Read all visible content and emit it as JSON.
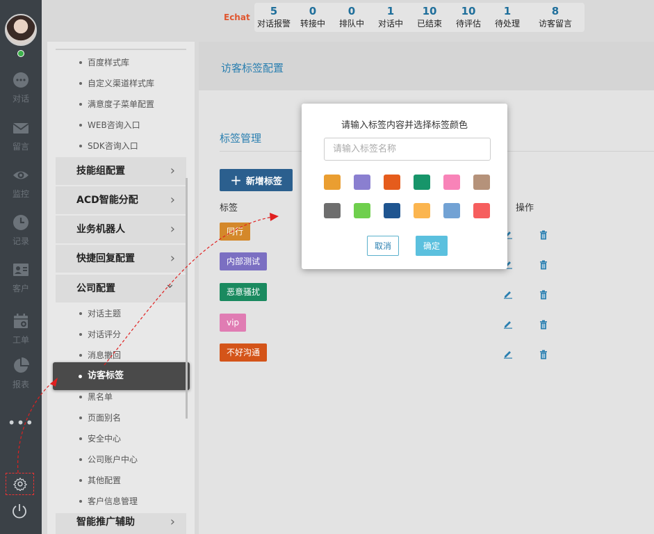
{
  "rail": {
    "items": [
      {
        "label": "对话",
        "icon": "chat-icon"
      },
      {
        "label": "留言",
        "icon": "mail-icon"
      },
      {
        "label": "监控",
        "icon": "eye-icon"
      },
      {
        "label": "记录",
        "icon": "clock-icon"
      },
      {
        "label": "客户",
        "icon": "contact-card-icon"
      },
      {
        "label": "工单",
        "icon": "calendar-icon"
      },
      {
        "label": "报表",
        "icon": "pie-chart-icon"
      }
    ],
    "more": "•••"
  },
  "topbar": {
    "logo": "Echat",
    "stats": [
      {
        "num": "5",
        "cap": "对话报警"
      },
      {
        "num": "0",
        "cap": "转接中"
      },
      {
        "num": "0",
        "cap": "排队中"
      },
      {
        "num": "1",
        "cap": "对话中"
      },
      {
        "num": "10",
        "cap": "已结束"
      },
      {
        "num": "10",
        "cap": "待评估"
      },
      {
        "num": "1",
        "cap": "待处理"
      },
      {
        "num": "8",
        "cap": "访客留言"
      }
    ]
  },
  "menu": {
    "top_subs": [
      "百度样式库",
      "自定义渠道样式库",
      "满意度子菜单配置",
      "WEB咨询入口",
      "SDK咨询入口"
    ],
    "groups": [
      "技能组配置",
      "ACD智能分配",
      "业务机器人",
      "快捷回复配置",
      "公司配置"
    ],
    "chevron_right": "›",
    "chevron_down": "⌄",
    "company_subs_before": [
      "对话主题",
      "对话评分",
      "消息撤回"
    ],
    "active": "访客标签",
    "company_subs_after": [
      "黑名单",
      "页面别名",
      "安全中心",
      "公司账户中心",
      "其他配置",
      "客户信息管理"
    ],
    "bottom_group": "智能推广辅助"
  },
  "main": {
    "page_title": "访客标签配置",
    "section_title": "标签管理",
    "add_button": "新增标签",
    "add_plus": "+",
    "col_tag": "标签",
    "col_op": "操作",
    "tags": [
      {
        "label": "同行",
        "color": "#d4882a"
      },
      {
        "label": "内部测试",
        "color": "#7b6fc2"
      },
      {
        "label": "恶意骚扰",
        "color": "#1a8a5f"
      },
      {
        "label": "vip",
        "color": "#e07cb3"
      },
      {
        "label": "不好沟通",
        "color": "#d45419"
      }
    ]
  },
  "modal": {
    "title": "请输入标签内容并选择标签颜色",
    "input_placeholder": "请输入标签名称",
    "input_value": "",
    "colors": [
      "#ea9e31",
      "#8a7fd0",
      "#e55c1c",
      "#17956a",
      "#f883b8",
      "#b5927a",
      "#6e6e6e",
      "#6fcf4d",
      "#1f5590",
      "#fbb54f",
      "#72a2d4",
      "#f65e5e"
    ],
    "cancel": "取消",
    "ok": "确定"
  }
}
